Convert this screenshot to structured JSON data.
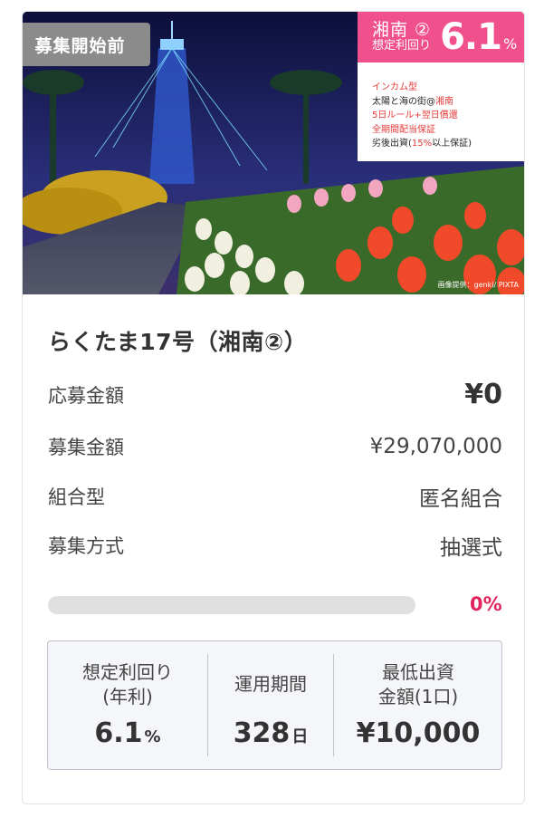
{
  "hero": {
    "status_badge": "募集開始前",
    "overlay": {
      "area": "湘南 ②",
      "yield_label": "想定利回り",
      "rate": "6.1",
      "rate_unit": "%",
      "lines": [
        "インカム型",
        "太陽と海の街@",
        "湘南",
        "5日ルール+翌日償還",
        "全期間配当保証",
        "劣後出資(",
        "15%",
        "以上保証)"
      ]
    },
    "credit": "画像提供：genki/ PIXTA"
  },
  "title": "らくたま17号（湘南②）",
  "rows": [
    {
      "label": "応募金額",
      "value": "¥0"
    },
    {
      "label": "募集金額",
      "value": "¥29,070,000"
    },
    {
      "label": "組合型",
      "value": "匿名組合"
    },
    {
      "label": "募集方式",
      "value": "抽選式"
    }
  ],
  "progress": {
    "percent_text": "0%",
    "fraction": 0.0
  },
  "stats": [
    {
      "label_line1": "想定利回り",
      "label_line2": "(年利)",
      "value": "6.1",
      "unit": "%"
    },
    {
      "label_line1": "運用期間",
      "label_line2": "",
      "value": "328",
      "unit": "日"
    },
    {
      "label_line1": "最低出資",
      "label_line2": "金額(1口)",
      "value": "¥10,000",
      "unit": ""
    }
  ],
  "colors": {
    "accent": "#e0245e",
    "overlay_pink": "#f0508c",
    "badge_gray": "#8b8b8b"
  }
}
